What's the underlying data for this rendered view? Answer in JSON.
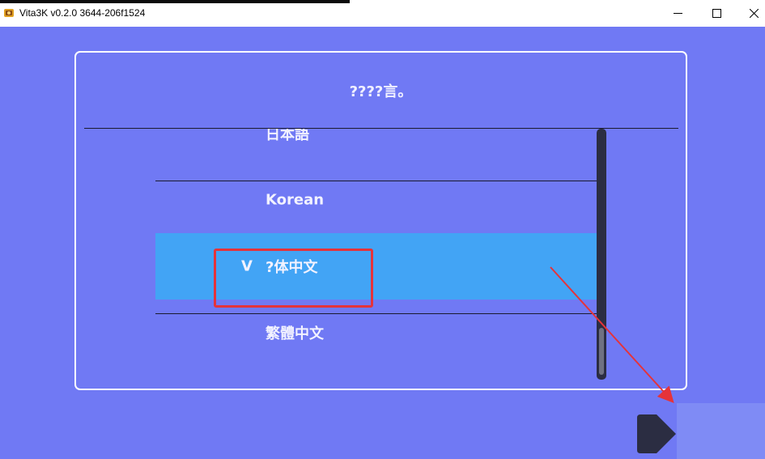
{
  "window": {
    "title": "Vita3K v0.2.0 3644-206f1524",
    "controls": [
      "minimize",
      "maximize",
      "close"
    ]
  },
  "dialog": {
    "header": "????言。",
    "languages": [
      {
        "label": "日本語",
        "selected": false
      },
      {
        "label": "Korean",
        "selected": false
      },
      {
        "label": "?体中文",
        "selected": true,
        "check_mark": "V"
      },
      {
        "label": "繁體中文",
        "selected": false
      }
    ],
    "scroll_position": 0.85
  },
  "annotation": {
    "highlight_color": "#e5333a",
    "arrow_color": "#e5333a"
  },
  "navigation": {
    "next_icon": "play-triangle-icon"
  },
  "colors": {
    "background": "#7079f4",
    "selected_row": "#42a4f5",
    "text": "#f2f2ff",
    "scrollbar": "#2b2d42"
  }
}
